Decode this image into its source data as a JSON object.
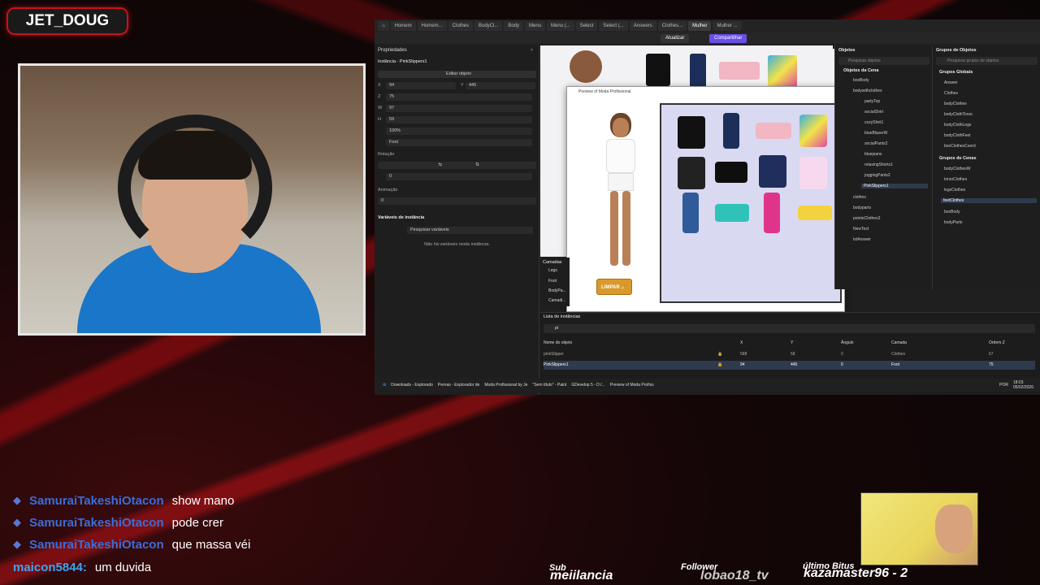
{
  "stream": {
    "name": "JET_DOUG"
  },
  "tabs": [
    "Homem",
    "Homem...",
    "Clothes",
    "BodyCl...",
    "Body",
    "Menu",
    "Menu (...",
    "Select",
    "Select (...",
    "Answers",
    "Clothes...",
    "Mulher",
    "Mulher ..."
  ],
  "active_tab": "Mulher",
  "toolbar": {
    "update": "Atualizar",
    "share": "Compartilhar"
  },
  "properties": {
    "title": "Propriedades",
    "instance": "Instância - PinkSlippers1",
    "edit_object": "Editar objeto",
    "x": "94",
    "y": "445",
    "z": "75",
    "w": "97",
    "h": "59",
    "opacity": "100%",
    "layer": "Foot",
    "rotation_label": "Rotação",
    "rotation": "0",
    "animation_label": "Animação",
    "animation": "0",
    "variables_title": "Variáveis de instância",
    "search_vars": "Pesquisar variáveis",
    "no_vars": "Não há variáveis nesta instância."
  },
  "preview": {
    "title": "Preview of Moda Profissional",
    "clear_button": "LIMPAR 🧹"
  },
  "layers": {
    "title": "Camadas",
    "items": [
      "Legs",
      "Foot",
      "BodyPa...",
      "Camadi..."
    ]
  },
  "instance_list": {
    "title": "Lista de instâncias",
    "search": "pi",
    "columns": [
      "Nome do objeto",
      "X",
      "Y",
      "Ângulo",
      "Camada",
      "Ordem Z"
    ],
    "rows": [
      [
        "pinkSlipper",
        "588",
        "58",
        "0",
        "Clothes",
        "67"
      ],
      [
        "PinkSlippers1",
        "94",
        "445",
        "0",
        "Foot",
        "75"
      ]
    ]
  },
  "objects": {
    "title": "Objetos",
    "search": "Pesquisar objetos",
    "scene_header": "Objetos da Cena",
    "items": [
      "boxBody",
      "bodywithclothes",
      "partyTop",
      "socialShirt",
      "cozyShirt1",
      "blueBlazerW",
      "socialPants2",
      "bluejeans",
      "relaxingShorts1",
      "joggingPants2",
      "PinkSlippers1",
      "clothes",
      "bodyparts",
      "pointeClothes3",
      "NewText",
      "txtAnswer"
    ],
    "selected": "PinkSlippers1"
  },
  "groups": {
    "title": "Grupos de Objetos",
    "search": "Pesquisar grupos de objetos",
    "global_header": "Grupos Globais",
    "global_items": [
      "Answer",
      "Clothes",
      "bodyClothes",
      "bodyClothTorso",
      "bodyClothLegs",
      "bodyClothFeet",
      "boxClothesCoord"
    ],
    "scene_header": "Grupos de Cenas",
    "scene_items": [
      "bodyClothesW",
      "torsoClothes",
      "legsClothes",
      "feetClothes",
      "boxBody",
      "bodyParts"
    ],
    "selected": "feetClothes"
  },
  "taskbar": {
    "items": [
      "Downloads - Explorado",
      "Pernas - Explorador de",
      "Moda Profissional by Je",
      "\"Sem título\" - Paint",
      "GDevelop 5 - D:/...",
      "Preview of Moda Profiss"
    ],
    "lang": "POR",
    "time": "18:03",
    "date": "05/02/2026"
  },
  "chat": [
    {
      "user": "SamuraiTakeshiOtacon",
      "msg": "show mano",
      "icon": "badge-icon"
    },
    {
      "user": "SamuraiTakeshiOtacon",
      "msg": "pode crer",
      "icon": "badge-icon"
    },
    {
      "user": "SamuraiTakeshiOtacon",
      "msg": "que massa véi",
      "icon": "badge-icon"
    },
    {
      "user": "maicon5844:",
      "msg": "um duvida",
      "icon": ""
    }
  ],
  "stats": {
    "sub_label": "Sub",
    "sub_value": "meiilancia",
    "follower_label": "Follower",
    "follower_value": "lobao18_tv",
    "bits_label": "último Bitus",
    "bits_value": "kazamaster96 - 2"
  },
  "colors": {
    "accent_red": "#c8121b",
    "share_purple": "#6a4ee6",
    "chat_user_blue": "#3a6dd8"
  }
}
